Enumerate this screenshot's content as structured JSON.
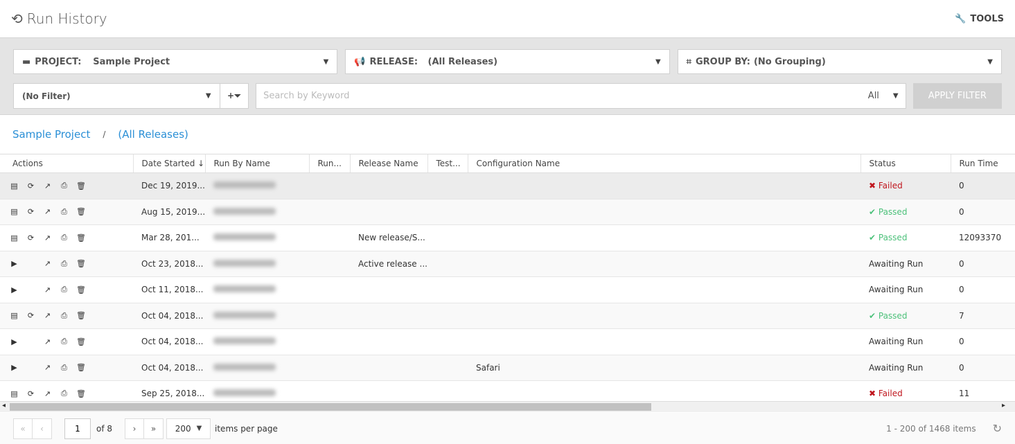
{
  "header": {
    "title": "Run History",
    "tools": "TOOLS"
  },
  "filters": {
    "project_label": "PROJECT:",
    "project_value": "Sample Project",
    "release_label": "RELEASE:",
    "release_value": "(All Releases)",
    "group_label": "GROUP BY:",
    "group_value": "(No Grouping)",
    "filter_value": "(No Filter)",
    "search_placeholder": "Search by Keyword",
    "scope": "All",
    "apply": "APPLY FILTER"
  },
  "breadcrumb": {
    "project": "Sample Project",
    "sep": "/",
    "release": "(All Releases)"
  },
  "columns": [
    "Actions",
    "Date Started ↓",
    "Run By Name",
    "Run...",
    "Release Name",
    "Test...",
    "Configuration Name",
    "Status",
    "Run Time"
  ],
  "rows": [
    {
      "type": "done",
      "date": "Dec 19, 2019...",
      "release": "",
      "config": "",
      "status": "Failed",
      "time": "0"
    },
    {
      "type": "done",
      "date": "Aug 15, 2019...",
      "release": "",
      "config": "",
      "status": "Passed",
      "time": "0"
    },
    {
      "type": "done",
      "date": "Mar 28, 201...",
      "release": "New release/S...",
      "config": "",
      "status": "Passed",
      "time": "12093370"
    },
    {
      "type": "await",
      "date": "Oct 23, 2018...",
      "release": "Active release ...",
      "config": "",
      "status": "Awaiting Run",
      "time": "0"
    },
    {
      "type": "await",
      "date": "Oct 11, 2018...",
      "release": "",
      "config": "",
      "status": "Awaiting Run",
      "time": "0"
    },
    {
      "type": "done",
      "date": "Oct 04, 2018...",
      "release": "",
      "config": "",
      "status": "Passed",
      "time": "7"
    },
    {
      "type": "await",
      "date": "Oct 04, 2018...",
      "release": "",
      "config": "",
      "status": "Awaiting Run",
      "time": "0"
    },
    {
      "type": "await",
      "date": "Oct 04, 2018...",
      "release": "",
      "config": "Safari",
      "status": "Awaiting Run",
      "time": "0"
    },
    {
      "type": "done",
      "date": "Sep 25, 2018...",
      "release": "",
      "config": "",
      "status": "Failed",
      "time": "11"
    }
  ],
  "pager": {
    "page": "1",
    "of": "of 8",
    "size": "200",
    "per_page": "items per page",
    "info": "1 - 200 of 1468 items"
  }
}
